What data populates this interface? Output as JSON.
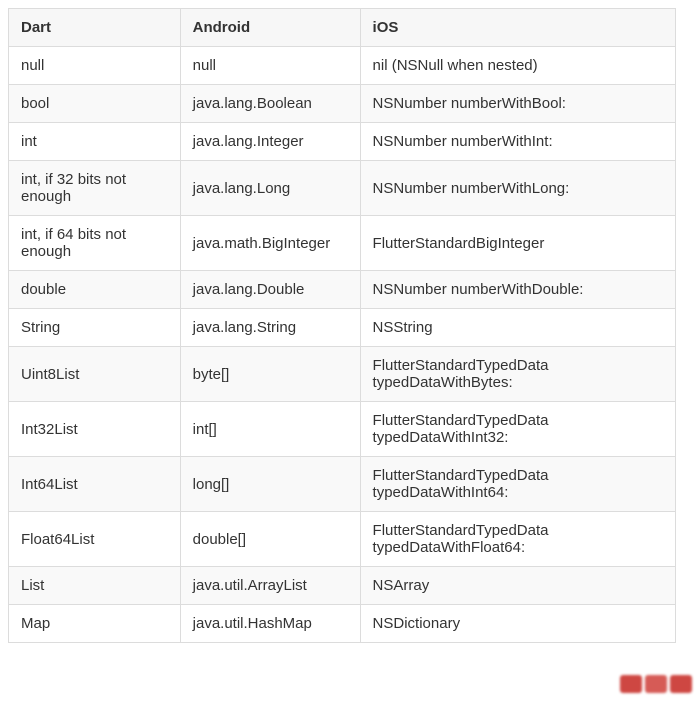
{
  "chart_data": {
    "type": "table",
    "columns": [
      "Dart",
      "Android",
      "iOS"
    ],
    "rows": [
      [
        "null",
        "null",
        "nil (NSNull when nested)"
      ],
      [
        "bool",
        "java.lang.Boolean",
        "NSNumber numberWithBool:"
      ],
      [
        "int",
        "java.lang.Integer",
        "NSNumber numberWithInt:"
      ],
      [
        "int, if 32 bits not enough",
        "java.lang.Long",
        "NSNumber numberWithLong:"
      ],
      [
        "int, if 64 bits not enough",
        "java.math.BigInteger",
        "FlutterStandardBigInteger"
      ],
      [
        "double",
        "java.lang.Double",
        "NSNumber numberWithDouble:"
      ],
      [
        "String",
        "java.lang.String",
        "NSString"
      ],
      [
        "Uint8List",
        "byte[]",
        "FlutterStandardTypedData typedDataWithBytes:"
      ],
      [
        "Int32List",
        "int[]",
        "FlutterStandardTypedData typedDataWithInt32:"
      ],
      [
        "Int64List",
        "long[]",
        "FlutterStandardTypedData typedDataWithInt64:"
      ],
      [
        "Float64List",
        "double[]",
        "FlutterStandardTypedData typedDataWithFloat64:"
      ],
      [
        "List",
        "java.util.ArrayList",
        "NSArray"
      ],
      [
        "Map",
        "java.util.HashMap",
        "NSDictionary"
      ]
    ]
  },
  "table": {
    "headers": {
      "dart": "Dart",
      "android": "Android",
      "ios": "iOS"
    },
    "rows": [
      {
        "dart": "null",
        "android": "null",
        "ios": "nil (NSNull when nested)"
      },
      {
        "dart": "bool",
        "android": "java.lang.Boolean",
        "ios": "NSNumber numberWithBool:"
      },
      {
        "dart": "int",
        "android": "java.lang.Integer",
        "ios": "NSNumber numberWithInt:"
      },
      {
        "dart": "int, if 32 bits not enough",
        "android": "java.lang.Long",
        "ios": "NSNumber numberWithLong:"
      },
      {
        "dart": "int, if 64 bits not enough",
        "android": "java.math.BigInteger",
        "ios": "FlutterStandardBigInteger"
      },
      {
        "dart": "double",
        "android": "java.lang.Double",
        "ios": "NSNumber numberWithDouble:"
      },
      {
        "dart": "String",
        "android": "java.lang.String",
        "ios": "NSString"
      },
      {
        "dart": "Uint8List",
        "android": "byte[]",
        "ios": "FlutterStandardTypedData typedDataWithBytes:"
      },
      {
        "dart": "Int32List",
        "android": "int[]",
        "ios": "FlutterStandardTypedData typedDataWithInt32:"
      },
      {
        "dart": "Int64List",
        "android": "long[]",
        "ios": "FlutterStandardTypedData typedDataWithInt64:"
      },
      {
        "dart": "Float64List",
        "android": "double[]",
        "ios": "FlutterStandardTypedData typedDataWithFloat64:"
      },
      {
        "dart": "List",
        "android": "java.util.ArrayList",
        "ios": "NSArray"
      },
      {
        "dart": "Map",
        "android": "java.util.HashMap",
        "ios": "NSDictionary"
      }
    ]
  }
}
